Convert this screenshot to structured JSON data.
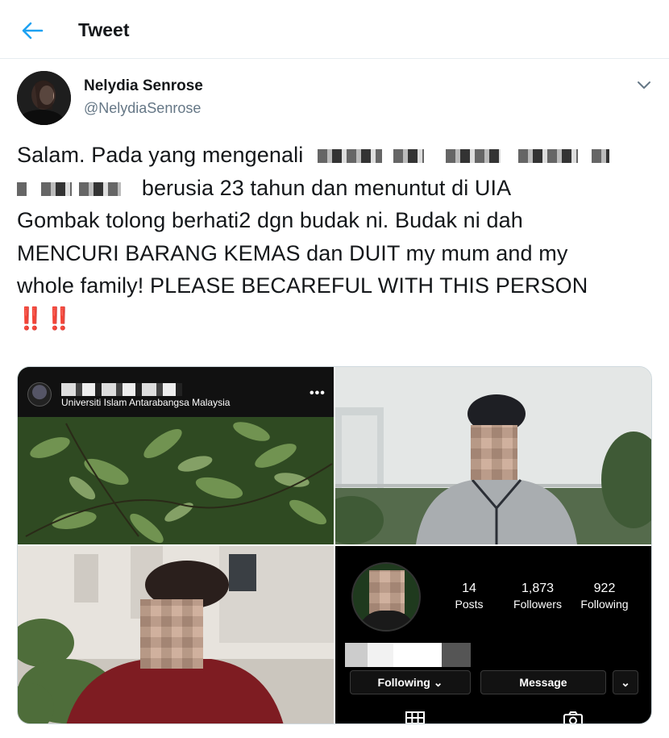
{
  "header": {
    "title": "Tweet"
  },
  "author": {
    "name": "Nelydia Senrose",
    "handle": "@NelydiaSenrose"
  },
  "tweet": {
    "line1_start": "Salam. Pada yang mengenali",
    "line2": "berusia 23 tahun dan menuntut di UIA",
    "line3": "Gombak tolong berhati2 dgn budak ni. Budak ni dah",
    "line4": "MENCURI BARANG KEMAS dan DUIT my mum and my",
    "line5": "whole family! PLEASE BECAREFUL WITH THIS PERSON",
    "emoji": "‼️ ‼️"
  },
  "media": {
    "instagram_post": {
      "location": "Universiti Islam Antarabangsa Malaysia",
      "more": "•••"
    },
    "instagram_profile": {
      "posts_count": "14",
      "posts_label": "Posts",
      "followers_count": "1,873",
      "followers_label": "Followers",
      "following_count": "922",
      "following_label": "Following",
      "following_button": "Following ⌄",
      "message_button": "Message",
      "dropdown_button": "⌄"
    }
  },
  "colors": {
    "accent": "#1da1f2",
    "text": "#14171a",
    "muted": "#657786",
    "alert": "#c0203a"
  },
  "icons": [
    "back-arrow-icon",
    "chevron-down-icon",
    "more-icon",
    "grid-icon",
    "camera-icon"
  ]
}
